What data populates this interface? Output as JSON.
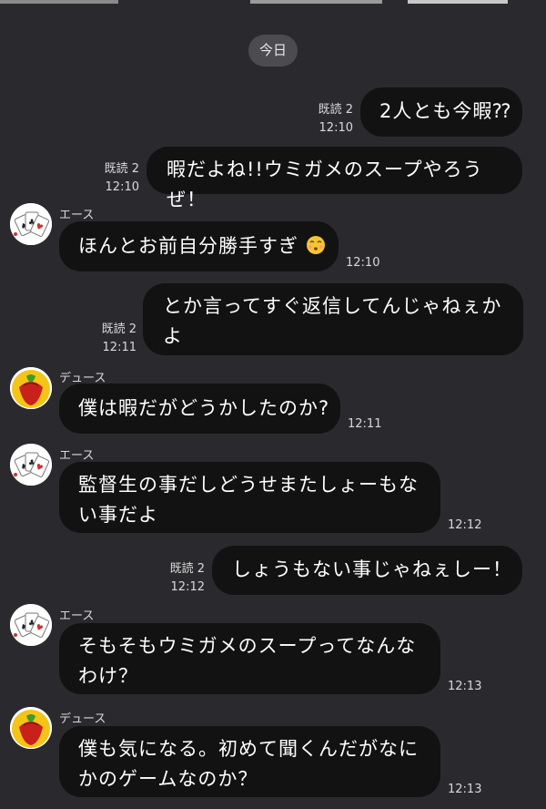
{
  "date_label": "今日",
  "read_label": "既読 2",
  "messages": [
    {
      "text": "2人とも今暇⁇",
      "time": "12:10"
    },
    {
      "text": "暇だよね!!ウミガメのスープやろうぜ！",
      "time": "12:10"
    },
    {
      "sender": "エース",
      "text": "ほんとお前自分勝手すぎ",
      "emoji": "face-emoji",
      "time": "12:10"
    },
    {
      "line1": "とか言ってすぐ返信してんじゃねぇか",
      "line2": "よ",
      "time": "12:11"
    },
    {
      "sender": "デュース",
      "text": "僕は暇だがどうかしたのか?",
      "time": "12:11"
    },
    {
      "sender": "エース",
      "line1": "監督生の事だしどうせまたしょーもな",
      "line2": "い事だよ",
      "time": "12:12"
    },
    {
      "text": "しょうもない事じゃねぇしー！",
      "time": "12:12"
    },
    {
      "sender": "エース",
      "line1": "そもそもウミガメのスープってなんな",
      "line2": "わけ？",
      "time": "12:13"
    },
    {
      "sender": "デュース",
      "line1": "僕も気になる。初めて聞くんだがなに",
      "line2": "かのゲームなのか？",
      "time": "12:13"
    }
  ],
  "colors": {
    "background": "#2a2a2e",
    "bubble": "#121212",
    "date_pill": "#4b4b50",
    "meta_text": "#d9d9d9"
  }
}
